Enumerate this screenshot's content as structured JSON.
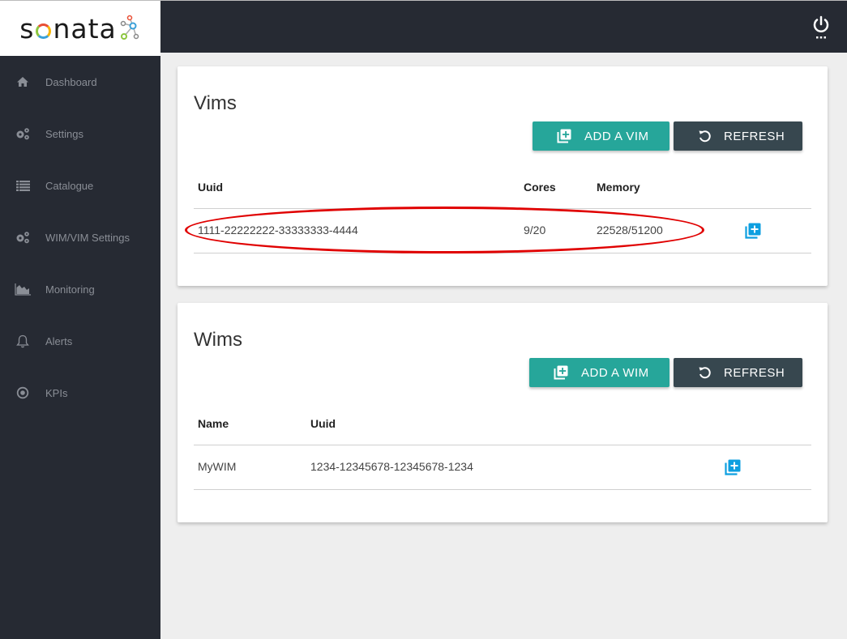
{
  "app": {
    "logo_text_prefix": "s",
    "logo_text_suffix": "nata",
    "brand_colors": {
      "sidebar": "#262a33",
      "primary": "#26a69a",
      "secondary": "#37474f",
      "action_icon": "#0d9fe0",
      "highlight": "#e00000"
    }
  },
  "sidebar": {
    "items": [
      {
        "label": "Dashboard",
        "icon": "home-icon"
      },
      {
        "label": "Settings",
        "icon": "gears-icon"
      },
      {
        "label": "Catalogue",
        "icon": "list-icon"
      },
      {
        "label": "WIM/VIM Settings",
        "icon": "gears-icon"
      },
      {
        "label": "Monitoring",
        "icon": "area-chart-icon"
      },
      {
        "label": "Alerts",
        "icon": "bell-icon"
      },
      {
        "label": "KPIs",
        "icon": "target-icon"
      }
    ]
  },
  "topbar": {
    "power_icon": "power-icon"
  },
  "vims": {
    "title": "Vims",
    "add_label": "ADD A VIM",
    "refresh_label": "REFRESH",
    "columns": [
      "Uuid",
      "Cores",
      "Memory"
    ],
    "rows": [
      {
        "uuid": "1111-22222222-33333333-4444",
        "cores": "9/20",
        "memory": "22528/51200"
      }
    ]
  },
  "wims": {
    "title": "Wims",
    "add_label": "ADD A WIM",
    "refresh_label": "REFRESH",
    "columns": [
      "Name",
      "Uuid"
    ],
    "rows": [
      {
        "name": "MyWIM",
        "uuid": "1234-12345678-12345678-1234"
      }
    ]
  }
}
